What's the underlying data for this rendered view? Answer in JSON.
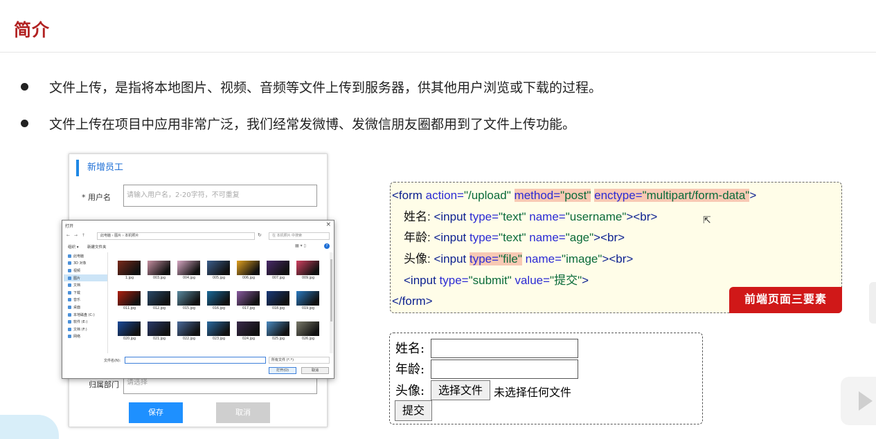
{
  "title": "简介",
  "bullets": [
    "文件上传，是指将本地图片、视频、音频等文件上传到服务器，供其他用户浏览或下载的过程。",
    "文件上传在项目中应用非常广泛，我们经常发微博、发微信朋友圈都用到了文件上传功能。"
  ],
  "employee_form": {
    "header": "新增员工",
    "username_label": "* 用户名",
    "username_placeholder": "请输入用户名，2-20字符，不可重复",
    "dept_label": "归属部门",
    "dept_placeholder": "请选择",
    "save_label": "保存",
    "cancel_label": "取消"
  },
  "file_dialog": {
    "title": "打开",
    "nav_buttons": "← → ↑",
    "address": "此电脑 › 图片 › 本机照片",
    "search_placeholder": "在 本机照片 中搜索",
    "organize_label": "组织 ▾",
    "new_folder_label": "新建文件夹",
    "view_icons": "▦ ▾ ▯",
    "help_icon": "?",
    "sidebar": [
      "此电脑",
      "3D 对象",
      "视频",
      "图片",
      "文档",
      "下载",
      "音乐",
      "桌面",
      "本地磁盘 (C:)",
      "软件 (E:)",
      "文档 (F:)",
      "网络"
    ],
    "selected_sidebar_index": 3,
    "files": [
      "1.jpg",
      "003.jpg",
      "004.jpg",
      "005.jpg",
      "006.jpg",
      "007.jpg",
      "009.jpg",
      "011.jpg",
      "012.jpg",
      "015.jpg",
      "016.jpg",
      "017.jpg",
      "018.jpg",
      "019.jpg",
      "020.jpg",
      "021.jpg",
      "022.jpg",
      "023.jpg",
      "024.jpg",
      "025.jpg",
      "026.jpg"
    ],
    "thumb_colors": [
      "#7a2a1a",
      "#c58ea0",
      "#d6a6c2",
      "#3b5e8c",
      "#e0a020",
      "#4a2a6a",
      "#d04060",
      "#b02010",
      "#2a4a6a",
      "#5a8aa0",
      "#1a6a9a",
      "#8a5aa0",
      "#1a3a7a",
      "#2a7ac0",
      "#1a4a9a",
      "#2a3a6a",
      "#4a6a9a",
      "#2a6aa0",
      "#3a2a4a",
      "#4a8ac0",
      "#7a7a6a"
    ],
    "filename_label": "文件名(N):",
    "filetype_value": "所有文件 (*.*)",
    "open_label": "打开(O)",
    "cancel_label": "取消"
  },
  "code": {
    "line1": {
      "open": "<form",
      "action_attr": " action=",
      "action_val": "\"/upload\"",
      "sp1": " ",
      "method_attr": "method=",
      "method_val": "\"post\"",
      "sp2": " ",
      "enctype_attr": "enctype=",
      "enctype_val": "\"multipart/form-data\"",
      "close": ">"
    },
    "line2": {
      "label": "姓名: ",
      "tag": "<input",
      "a1": " type=",
      "v1": "\"text\"",
      "a2": " name=",
      "v2": "\"username\"",
      "close": "><br>"
    },
    "line3": {
      "label": "年龄: ",
      "tag": "<input",
      "a1": " type=",
      "v1": "\"text\"",
      "a2": " name=",
      "v2": "\"age\"",
      "close": "><br>"
    },
    "line4": {
      "label": "头像: ",
      "tag": "<input",
      "sp": " ",
      "a1": "type=",
      "v1": "\"file\"",
      "a2": " name=",
      "v2": "\"image\"",
      "close": "><br>"
    },
    "line5": {
      "tag": "<input",
      "a1": " type=",
      "v1": "\"submit\"",
      "a2": " value=",
      "v2": "\"提交\"",
      "close": ">"
    },
    "line6": "</form>",
    "badge": "前端页面三要素"
  },
  "demo_form": {
    "name_label": "姓名:",
    "age_label": "年龄:",
    "avatar_label": "头像:",
    "file_button": "选择文件",
    "file_status": "未选择任何文件",
    "submit": "提交"
  }
}
